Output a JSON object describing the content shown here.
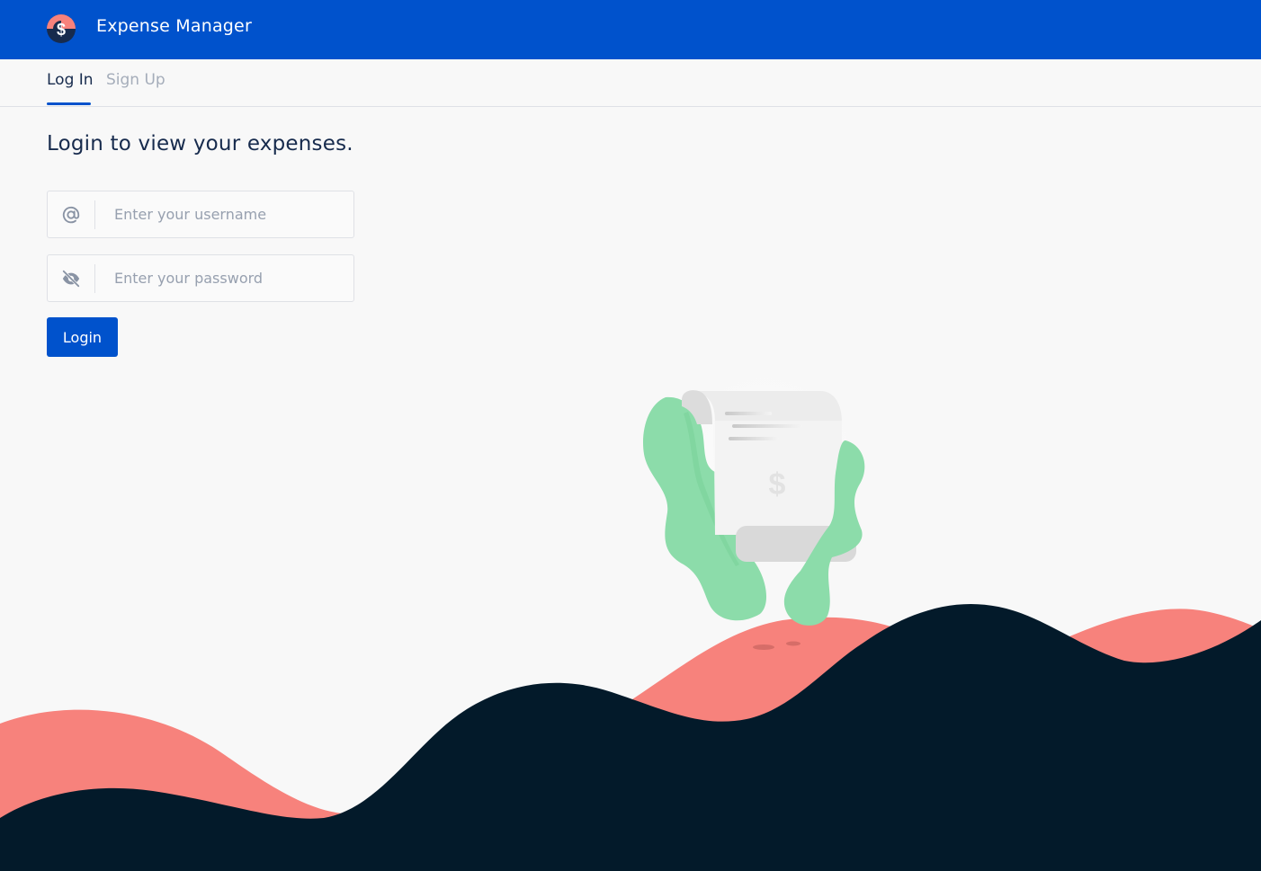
{
  "header": {
    "app_title": "Expense Manager",
    "brand_color": "#0052cc",
    "logo_icon": "dollar-coin-icon"
  },
  "tabs": [
    {
      "label": "Log In",
      "active": true
    },
    {
      "label": "Sign Up",
      "active": false
    }
  ],
  "login": {
    "heading": "Login to view your expenses.",
    "username": {
      "placeholder": "Enter your username",
      "value": "",
      "icon": "at-sign-icon"
    },
    "password": {
      "placeholder": "Enter your password",
      "value": "",
      "icon": "eye-slash-icon"
    },
    "submit_label": "Login"
  },
  "colors": {
    "wave_dark": "#031a2a",
    "wave_coral": "#f7827c",
    "plant_green": "#8cdcaa"
  }
}
